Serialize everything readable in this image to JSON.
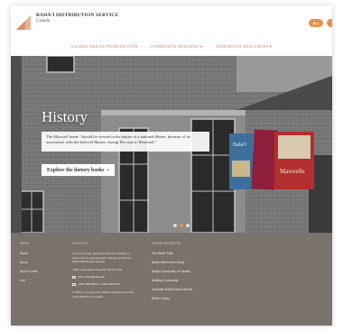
{
  "header": {
    "brand_name": "BAHÁ'Í DISTRIBUTION SERVICE",
    "brand_sub": "Canada",
    "cart_count": "0"
  },
  "nav": {
    "items": [
      {
        "label": "SACRED AND AUTHORITATIVE ▾"
      },
      {
        "label": "COMMUNITY BUILDING ▾"
      },
      {
        "label": "ADDITIONAL RESOURCES ▾"
      }
    ]
  },
  "hero": {
    "title": "History",
    "quote": "The Maxwell home \"should be viewed in the nature of a national Shrine, because of its association with the beloved Master, during His visit to Montreal.\"",
    "cta_label": "Explore the history books",
    "cta_arrow": "›",
    "books": [
      "Bahá'í",
      "Maxwells"
    ],
    "slide_index": 1,
    "slide_count": 3
  },
  "footer": {
    "menu_heading": "MENU",
    "menu": [
      "Home",
      "About",
      "How to Order",
      "Cart"
    ],
    "contact_heading": "CONTACT",
    "contact_text": "If you have any questions about this website or about how to order products, please contact the Bahá'í Distribution Service.",
    "address": "7200 Leslie Street Thornhill ON L3T 6L8",
    "email": "bds.orders@bahai.ca",
    "phone": "(905) 889-8168 or 1-800-465-3287",
    "copyright": "© 2024, a service of the Bahá'í Spiritual Assembly of the Bahá'ís of Canada",
    "other_heading": "OTHER WEBSITES",
    "other": [
      "The Bahá'í Faith",
      "Bahá'í Reference Library",
      "Bahá'í Community of Canada",
      "Building Community",
      "Canadian Bahá'í News Service",
      "Bahá'í Library"
    ]
  },
  "colors": {
    "accent": "#e6914e",
    "nav_text": "#c87f63",
    "footer_bg": "#7a736c"
  }
}
